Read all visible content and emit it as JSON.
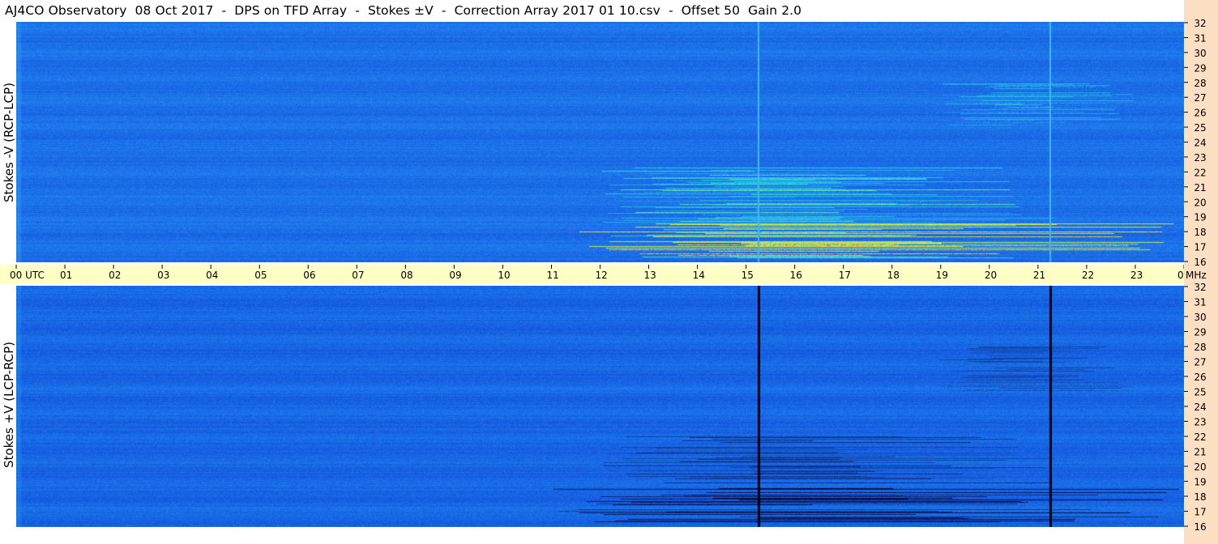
{
  "header": {
    "title": "AJ4CO Observatory  08 Oct 2017  -  DPS on TFD Array  -  Stokes ±V  -  Correction Array 2017 01 10.csv  -  Offset 50  Gain 2.0"
  },
  "chart_data": [
    {
      "type": "heatmap",
      "panel": "top",
      "ylabel": "Stokes -V (RCP-LCP)",
      "x_ticks": [
        "00 UTC",
        "01",
        "02",
        "03",
        "04",
        "05",
        "06",
        "07",
        "08",
        "09",
        "10",
        "11",
        "12",
        "13",
        "14",
        "15",
        "16",
        "17",
        "18",
        "19",
        "20",
        "21",
        "22",
        "23",
        "00"
      ],
      "x_unit": "UTC",
      "xlim": [
        0,
        24
      ],
      "y_ticks": [
        "32",
        "31",
        "30",
        "29",
        "28",
        "27",
        "26",
        "25",
        "24",
        "23",
        "22",
        "21",
        "20",
        "19",
        "18",
        "17",
        "16"
      ],
      "y_unit": "MHz",
      "ylim": [
        16,
        32
      ],
      "vertical_lines_hours": [
        15.25,
        21.25
      ],
      "bursts": [
        {
          "start_hour": 11.0,
          "end_hour": 24.0,
          "freq_mhz": [
            16.3,
            18.6
          ],
          "polarity": "positive",
          "strength": "high"
        },
        {
          "start_hour": 12.0,
          "end_hour": 21.5,
          "freq_mhz": [
            18.6,
            22.3
          ],
          "polarity": "positive",
          "strength": "moderate"
        },
        {
          "start_hour": 19.0,
          "end_hour": 23.0,
          "freq_mhz": [
            25.0,
            28.0
          ],
          "polarity": "positive",
          "strength": "weak"
        }
      ]
    },
    {
      "type": "heatmap",
      "panel": "bottom",
      "ylabel": "Stokes +V (LCP-RCP)",
      "x_ticks": [
        "00 UTC",
        "01",
        "02",
        "03",
        "04",
        "05",
        "06",
        "07",
        "08",
        "09",
        "10",
        "11",
        "12",
        "13",
        "14",
        "15",
        "16",
        "17",
        "18",
        "19",
        "20",
        "21",
        "22",
        "23",
        "00"
      ],
      "x_unit": "UTC",
      "xlim": [
        0,
        24
      ],
      "y_ticks": [
        "32",
        "31",
        "30",
        "29",
        "28",
        "27",
        "26",
        "25",
        "24",
        "23",
        "22",
        "21",
        "20",
        "19",
        "18",
        "17",
        "16"
      ],
      "y_unit": "MHz",
      "ylim": [
        16,
        32
      ],
      "vertical_lines_hours": [
        15.25,
        21.25
      ],
      "bursts": [
        {
          "start_hour": 11.0,
          "end_hour": 24.0,
          "freq_mhz": [
            16.3,
            18.6
          ],
          "polarity": "negative",
          "strength": "high"
        },
        {
          "start_hour": 12.0,
          "end_hour": 21.5,
          "freq_mhz": [
            18.6,
            22.3
          ],
          "polarity": "negative",
          "strength": "moderate"
        },
        {
          "start_hour": 19.0,
          "end_hour": 23.0,
          "freq_mhz": [
            25.0,
            28.0
          ],
          "polarity": "negative",
          "strength": "weak"
        }
      ]
    }
  ],
  "freq_unit_label": "MHz",
  "colors": {
    "background": "#1a6fe6",
    "time_band": "#ffffc6",
    "freq_strip": "#fddfc3"
  }
}
